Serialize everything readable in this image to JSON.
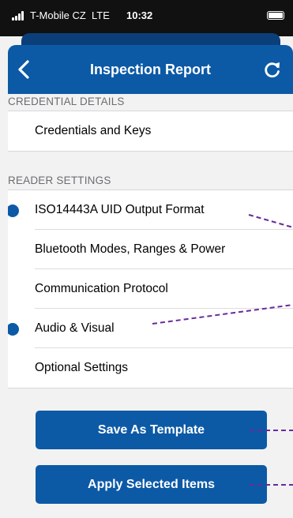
{
  "status_bar": {
    "carrier": "T-Mobile CZ",
    "network": "LTE",
    "time": "10:32",
    "signal_bars": 4
  },
  "navbar": {
    "title": "Inspection Report",
    "back_icon": "chevron-left-icon",
    "refresh_icon": "refresh-icon"
  },
  "sections": [
    {
      "header": "CREDENTIAL DETAILS",
      "items": [
        {
          "label": "Credentials and Keys",
          "changed": false
        }
      ]
    },
    {
      "header": "READER SETTINGS",
      "items": [
        {
          "label": "ISO14443A UID Output Format",
          "changed": true
        },
        {
          "label": "Bluetooth Modes, Ranges & Power",
          "changed": false
        },
        {
          "label": "Communication Protocol",
          "changed": false
        },
        {
          "label": "Audio & Visual",
          "changed": true
        },
        {
          "label": "Optional Settings",
          "changed": false
        }
      ]
    }
  ],
  "buttons": {
    "save_template": "Save As Template",
    "apply_selected": "Apply Selected Items"
  },
  "colors": {
    "accent": "#0c5aa6",
    "dark_accent": "#0b3f7a",
    "annotation": "#6a2a9a",
    "background": "#f2f2f2"
  }
}
